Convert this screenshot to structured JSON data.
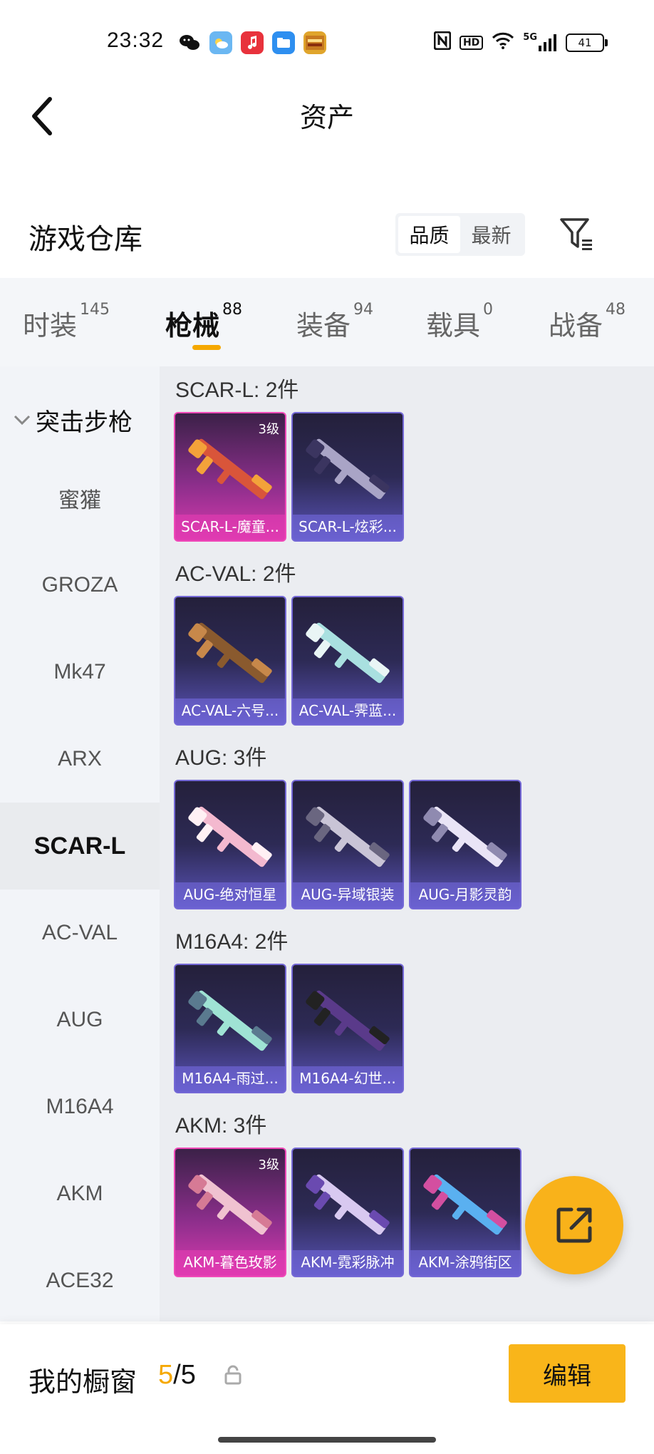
{
  "status_bar": {
    "time": "23:32",
    "apps": [
      "wechat-icon",
      "weather-icon",
      "music-icon",
      "files-icon",
      "game-icon"
    ],
    "right_icons": [
      "nfc-icon",
      "hd-icon",
      "wifi-icon",
      "signal-5g-icon"
    ],
    "hd": "HD",
    "net": "5G",
    "battery": "41"
  },
  "header": {
    "title": "资产"
  },
  "warehouse": {
    "title": "游戏仓库",
    "sort_options": [
      {
        "label": "品质",
        "active": true
      },
      {
        "label": "最新",
        "active": false
      }
    ]
  },
  "tabs": [
    {
      "label": "时装",
      "count": "145",
      "active": false
    },
    {
      "label": "枪械",
      "count": "88",
      "active": true
    },
    {
      "label": "装备",
      "count": "94",
      "active": false
    },
    {
      "label": "载具",
      "count": "0",
      "active": false
    },
    {
      "label": "战备",
      "count": "48",
      "active": false
    }
  ],
  "sidenav": {
    "group": "突击步枪",
    "items": [
      {
        "label": "蜜獾",
        "active": false
      },
      {
        "label": "GROZA",
        "active": false
      },
      {
        "label": "Mk47",
        "active": false
      },
      {
        "label": "ARX",
        "active": false
      },
      {
        "label": "SCAR-L",
        "active": true
      },
      {
        "label": "AC-VAL",
        "active": false
      },
      {
        "label": "AUG",
        "active": false
      },
      {
        "label": "M16A4",
        "active": false
      },
      {
        "label": "AKM",
        "active": false
      },
      {
        "label": "ACE32",
        "active": false
      }
    ]
  },
  "sections": [
    {
      "title": "SCAR-L: 2件",
      "items": [
        {
          "name": "SCAR-L-魔童...",
          "level": "3级",
          "rarity": "gold"
        },
        {
          "name": "SCAR-L-炫彩...",
          "level": "",
          "rarity": "purple"
        }
      ]
    },
    {
      "title": "AC-VAL: 2件",
      "items": [
        {
          "name": "AC-VAL-六号...",
          "level": "",
          "rarity": "purple"
        },
        {
          "name": "AC-VAL-霁蓝...",
          "level": "",
          "rarity": "purple"
        }
      ]
    },
    {
      "title": "AUG: 3件",
      "items": [
        {
          "name": "AUG-绝对恒星",
          "level": "",
          "rarity": "purple"
        },
        {
          "name": "AUG-异域银装",
          "level": "",
          "rarity": "purple"
        },
        {
          "name": "AUG-月影灵韵",
          "level": "",
          "rarity": "purple"
        }
      ]
    },
    {
      "title": "M16A4: 2件",
      "items": [
        {
          "name": "M16A4-雨过...",
          "level": "",
          "rarity": "purple"
        },
        {
          "name": "M16A4-幻世...",
          "level": "",
          "rarity": "purple"
        }
      ]
    },
    {
      "title": "AKM: 3件",
      "items": [
        {
          "name": "AKM-暮色玫影",
          "level": "3级",
          "rarity": "gold"
        },
        {
          "name": "AKM-霓彩脉冲",
          "level": "",
          "rarity": "purple"
        },
        {
          "name": "AKM-涂鸦街区",
          "level": "",
          "rarity": "purple"
        }
      ]
    }
  ],
  "bottom": {
    "label": "我的橱窗",
    "current": "5",
    "separator": "/",
    "total": "5",
    "edit_label": "编辑"
  },
  "colors": {
    "accent": "#f9b51a",
    "gold_card": "#f049b8",
    "purple_card": "#7468d6"
  }
}
